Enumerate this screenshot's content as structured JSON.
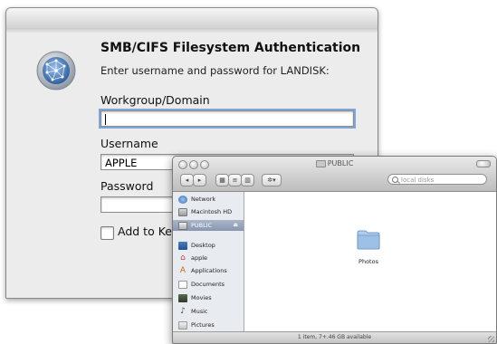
{
  "auth_dialog": {
    "title": "SMB/CIFS Filesystem Authentication",
    "message": "Enter username and password for LANDISK:",
    "workgroup_label": "Workgroup/Domain",
    "workgroup_value": "",
    "username_label": "Username",
    "username_value": "APPLE",
    "password_label": "Password",
    "password_value": "",
    "keychain_label": "Add to Keychain",
    "keychain_checked": false
  },
  "finder": {
    "title": "PUBLIC",
    "search_placeholder": "local disks",
    "sidebar": {
      "devices": [
        {
          "label": "Network",
          "icon": "network-icon"
        },
        {
          "label": "Macintosh HD",
          "icon": "hard-drive-icon"
        },
        {
          "label": "PUBLIC",
          "icon": "network-volume-icon",
          "selected": true
        }
      ],
      "places": [
        {
          "label": "Desktop",
          "icon": "desktop-icon"
        },
        {
          "label": "apple",
          "icon": "home-icon"
        },
        {
          "label": "Applications",
          "icon": "applications-icon"
        },
        {
          "label": "Documents",
          "icon": "documents-icon"
        },
        {
          "label": "Movies",
          "icon": "movies-icon"
        },
        {
          "label": "Music",
          "icon": "music-icon"
        },
        {
          "label": "Pictures",
          "icon": "pictures-icon"
        }
      ]
    },
    "items": [
      {
        "name": "Photos",
        "icon": "folder-icon"
      }
    ],
    "status": "1 item, 7+.46 GB available"
  },
  "colors": {
    "selection": "#8797b0",
    "folder": "#8fb4de"
  }
}
